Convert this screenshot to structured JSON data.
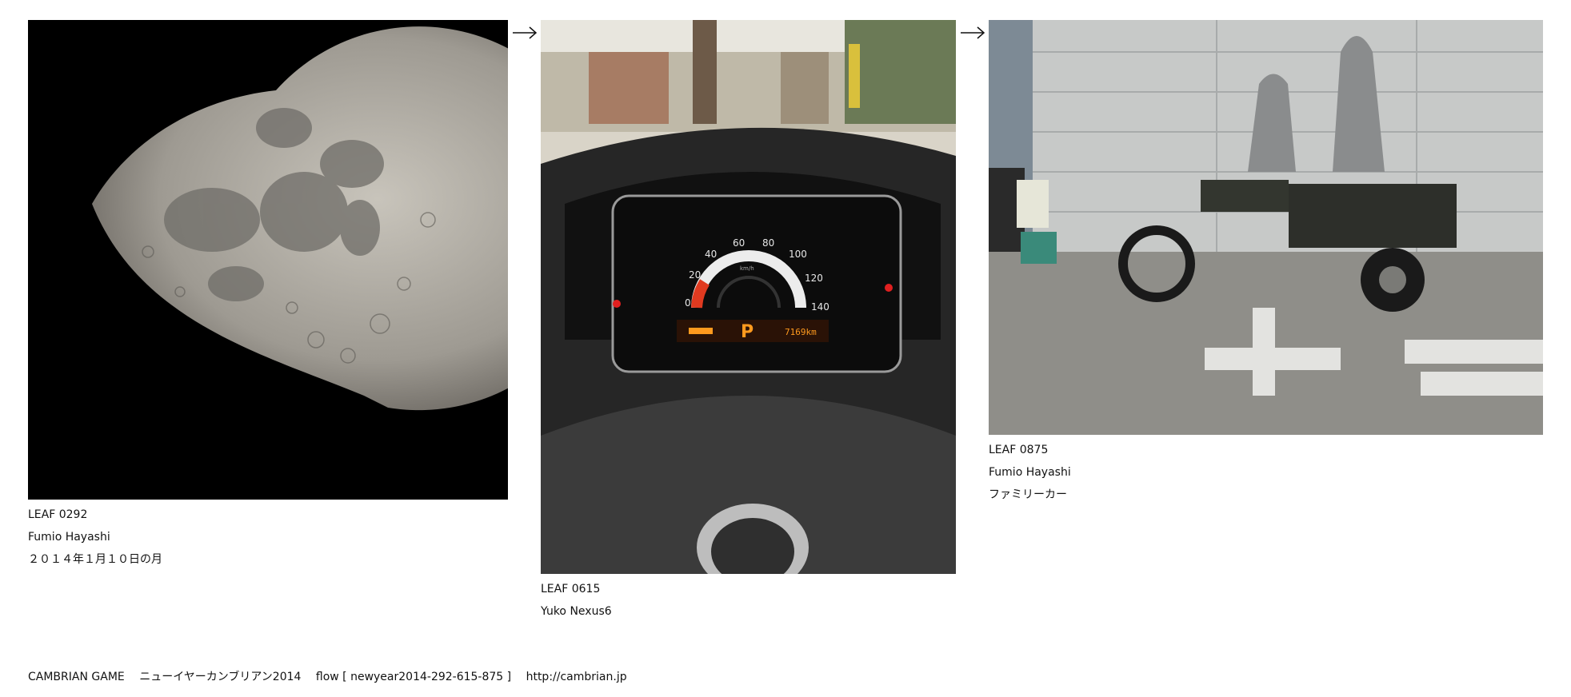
{
  "leaves": [
    {
      "id": "LEAF 0292",
      "author": "Fumio Hayashi",
      "title": "２０１４年１月１０日の月",
      "image_icon": "moon-photo"
    },
    {
      "id": "LEAF 0615",
      "author": "Yuko Nexus6",
      "title": "",
      "image_icon": "car-dashboard-photo"
    },
    {
      "id": "LEAF 0875",
      "author": "Fumio Hayashi",
      "title": "ファミリーカー",
      "image_icon": "three-wheeler-photo"
    }
  ],
  "footer": {
    "game": "CAMBRIAN GAME",
    "name": "ニューイヤーカンブリアン2014",
    "flow": "flow [ newyear2014-292-615-875 ]",
    "url": "http://cambrian.jp"
  },
  "dashboard": {
    "gear": "P",
    "speed_ticks": [
      "0",
      "20",
      "40",
      "60",
      "80",
      "100",
      "120",
      "140"
    ],
    "speed_unit": "km/h",
    "odometer": "7169km"
  }
}
